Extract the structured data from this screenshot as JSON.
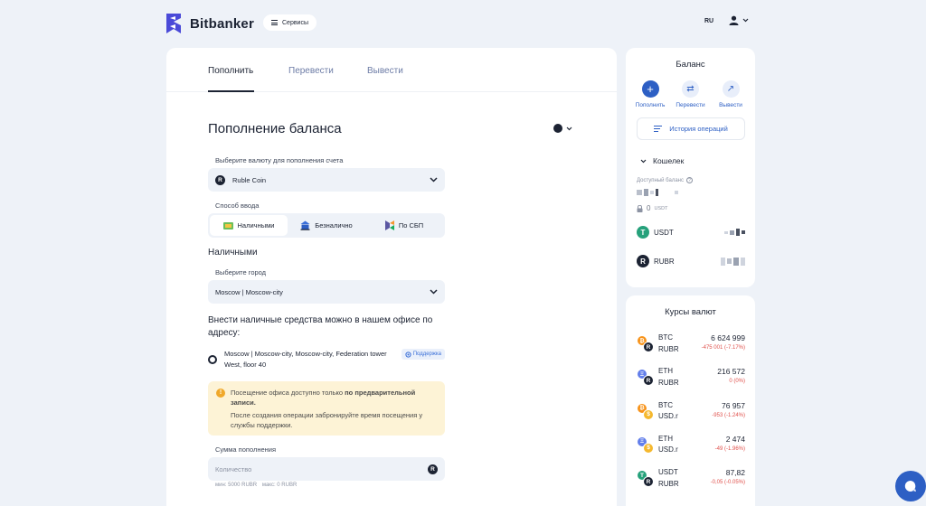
{
  "header": {
    "brand": "Bitbanker",
    "services_label": "Сервисы",
    "language": "RU"
  },
  "tabs": [
    {
      "label": "Пополнить",
      "active": true
    },
    {
      "label": "Перевести",
      "active": false
    },
    {
      "label": "Вывести",
      "active": false
    }
  ],
  "deposit": {
    "title": "Пополнение баланса",
    "currency_label": "Выберите валюту для пополнения счета",
    "currency_value": "Ruble Coin",
    "currency_icon": "R",
    "method_label": "Способ ввода",
    "methods": [
      "Наличными",
      "Безналично",
      "По СБП"
    ],
    "selected_method": "Наличными",
    "cash_heading": "Наличными",
    "city_label": "Выберите город",
    "city_value": "Moscow | Moscow-city",
    "office_text": "Внести наличные средства можно в нашем офисе по адресу:",
    "address": "Moscow | Moscow-city, Moscow-city, Federation tower West, floor 40",
    "support_label": "Поддержка",
    "notice_line1_plain": "Посещение офиса доступно только ",
    "notice_line1_bold": "по предварительной записи.",
    "notice_line2": "После создания операции забронируйте время посещения у службы поддержки.",
    "amount_label": "Сумма пополнения",
    "amount_placeholder": "Количество",
    "min_hint": "мин: 5000 RUBR",
    "max_hint": "макс: 0 RUBR"
  },
  "balance": {
    "title": "Баланс",
    "actions": [
      {
        "label": "Пополнить",
        "icon": "plus-icon"
      },
      {
        "label": "Перевести",
        "icon": "transfer-icon"
      },
      {
        "label": "Вывести",
        "icon": "arrow-up-right-icon"
      }
    ],
    "history_label": "История операций",
    "wallet_label": "Кошелек",
    "available_label": "Доступный баланс",
    "locked_value": "0",
    "locked_unit": "USDT",
    "assets": [
      {
        "name": "USDT",
        "icon": "T",
        "color": "#26a17b"
      },
      {
        "name": "RUBR",
        "icon": "R",
        "color": "#1c2333"
      }
    ]
  },
  "rates": {
    "title": "Курсы валют",
    "items": [
      {
        "base": "BTC",
        "quote": "RUBR",
        "price": "6 624 999",
        "change": "-475 001 (-7.17%)",
        "c1": "#f7931a",
        "c1_glyph": "₿",
        "c2": "#1c2333",
        "c2_glyph": "R"
      },
      {
        "base": "ETH",
        "quote": "RUBR",
        "price": "216 572",
        "change": "0 (0%)",
        "c1": "#627eea",
        "c1_glyph": "Ξ",
        "c2": "#1c2333",
        "c2_glyph": "R"
      },
      {
        "base": "BTC",
        "quote": "USD.r",
        "price": "76 957",
        "change": "-953 (-1.24%)",
        "c1": "#f7931a",
        "c1_glyph": "₿",
        "c2": "#f5b82e",
        "c2_glyph": "$"
      },
      {
        "base": "ETH",
        "quote": "USD.r",
        "price": "2 474",
        "change": "-49 (-1.96%)",
        "c1": "#627eea",
        "c1_glyph": "Ξ",
        "c2": "#f5b82e",
        "c2_glyph": "$"
      },
      {
        "base": "USDT",
        "quote": "RUBR",
        "price": "87,82",
        "change": "-0,05 (-0.05%)",
        "c1": "#26a17b",
        "c1_glyph": "T",
        "c2": "#1c2333",
        "c2_glyph": "R"
      }
    ]
  },
  "colors": {
    "accent": "#2d5fc4",
    "background": "#eef2f8",
    "negative": "#e0504b",
    "notice_bg": "#fdf3d6"
  }
}
